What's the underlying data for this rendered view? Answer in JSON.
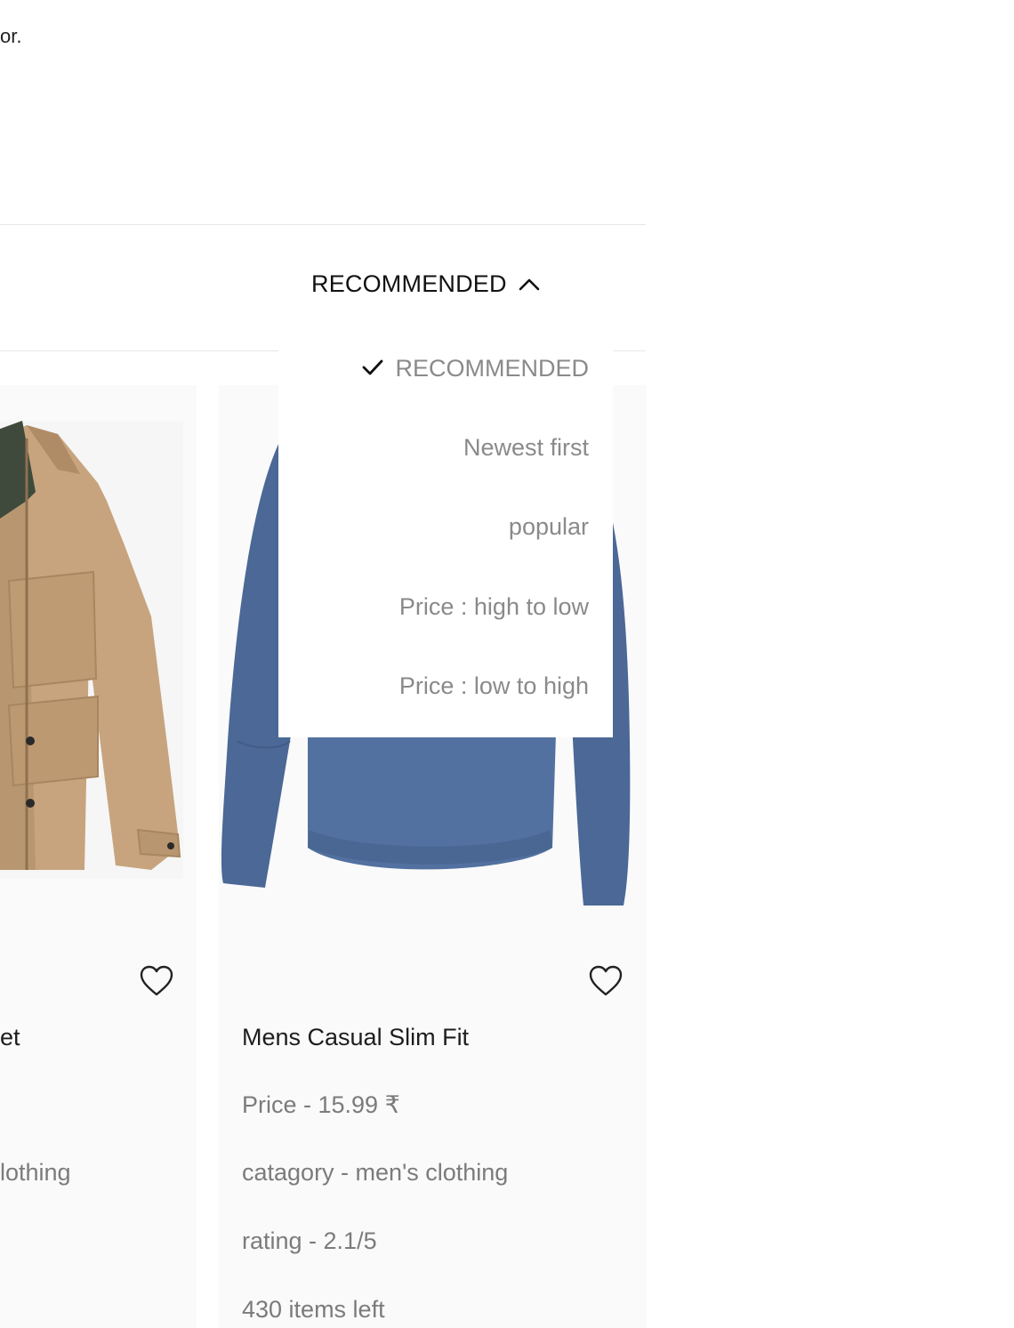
{
  "intro": {
    "text_fragment": "or."
  },
  "sort": {
    "current_label": "RECOMMENDED",
    "options": [
      {
        "label": "RECOMMENDED",
        "selected": true
      },
      {
        "label": "Newest first",
        "selected": false
      },
      {
        "label": "popular",
        "selected": false
      },
      {
        "label": "Price : high to low",
        "selected": false
      },
      {
        "label": "Price : low to high",
        "selected": false
      }
    ]
  },
  "products": [
    {
      "title": "et",
      "category": "lothing",
      "image": "tan-jacket"
    },
    {
      "title": "Mens Casual Slim Fit",
      "price": "Price - 15.99 ₹",
      "category": "catagory - men's clothing",
      "rating": "rating - 2.1/5",
      "stock": "430 items left",
      "image": "blue-long-sleeve-tshirt"
    }
  ],
  "icons": {
    "sort_toggle": "chevron-up-icon",
    "selected_option": "check-icon",
    "wishlist": "heart-outline-icon"
  },
  "colors": {
    "text_primary": "#111111",
    "text_muted": "#8a8a8a",
    "card_bg": "#fafafa",
    "divider": "#e6e6e6"
  }
}
